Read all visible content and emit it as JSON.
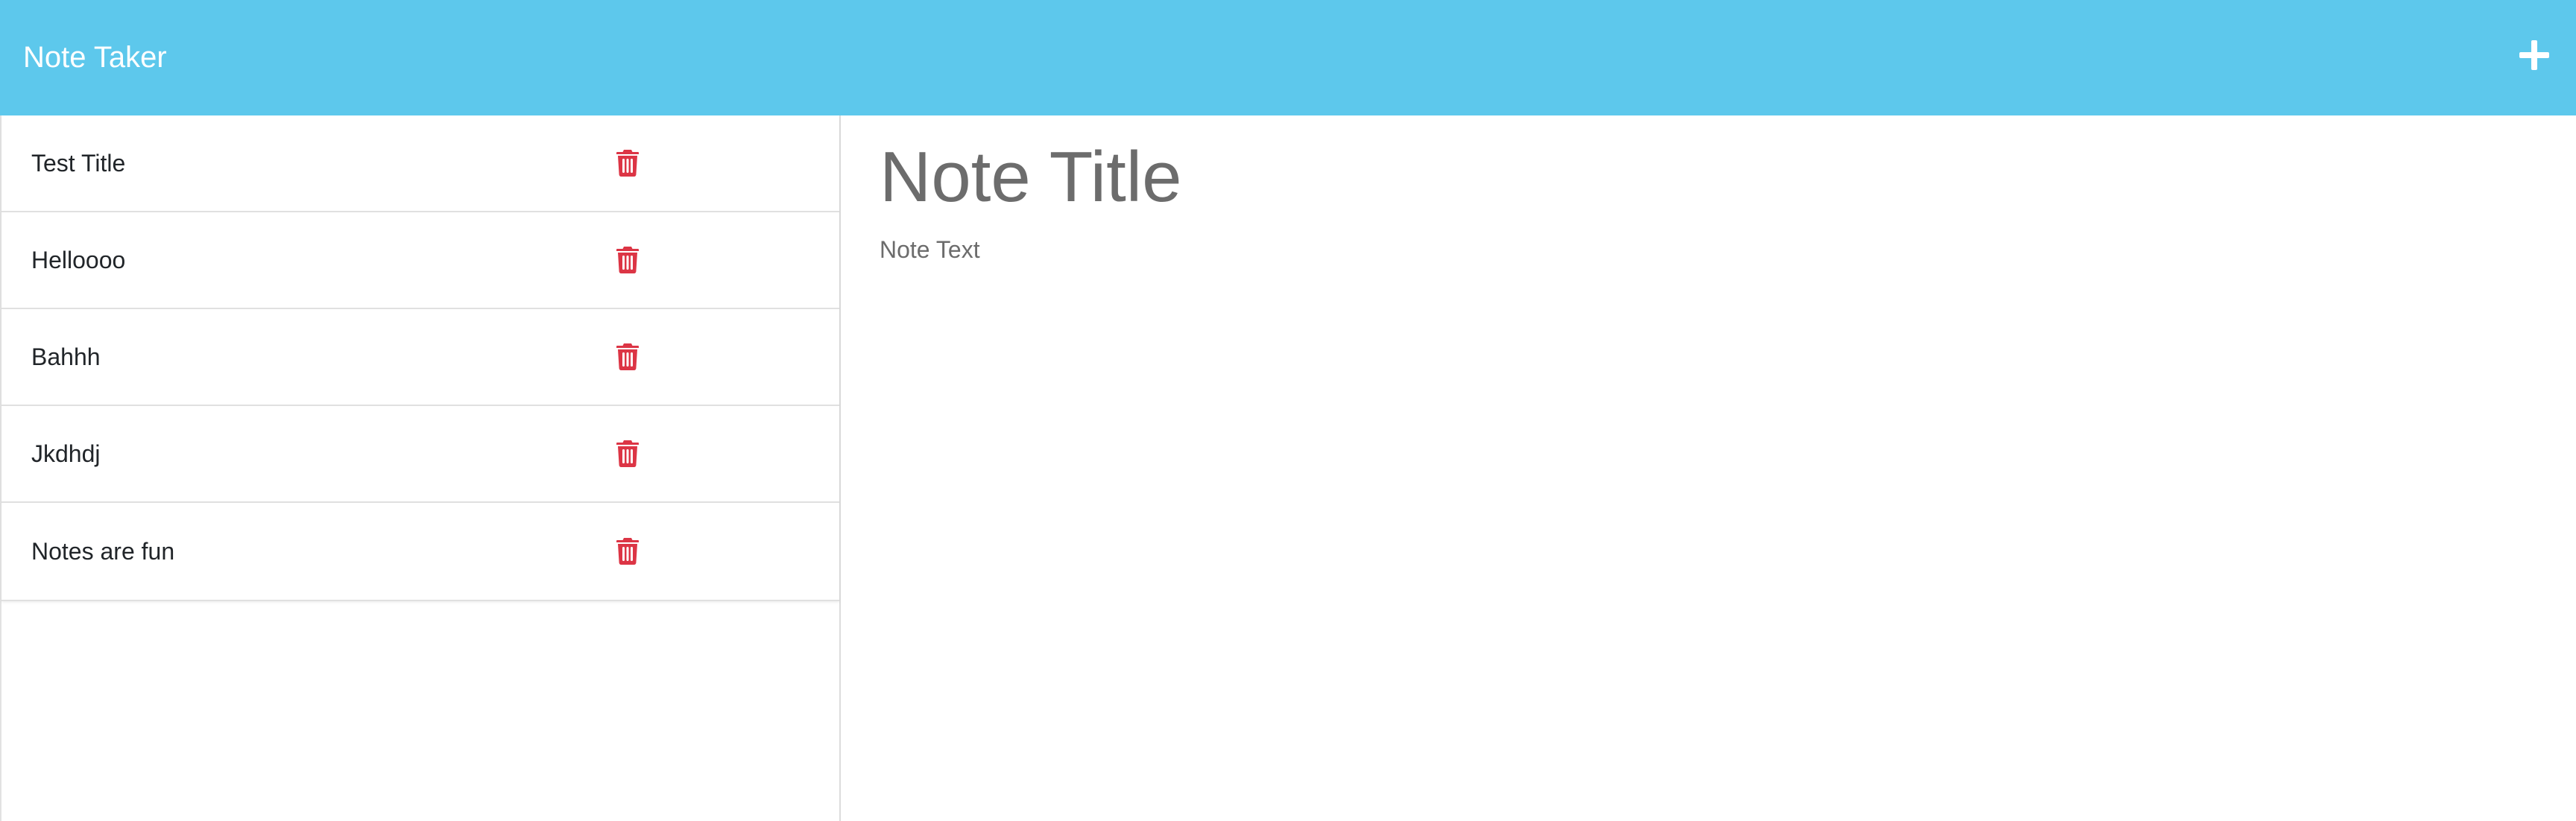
{
  "navbar": {
    "brand": "Note Taker",
    "add_icon": "plus-icon",
    "color": "#5dc8ec"
  },
  "notes": [
    {
      "title": "Test Title",
      "delete_icon": "trash-icon"
    },
    {
      "title": "Helloooo",
      "delete_icon": "trash-icon"
    },
    {
      "title": "Bahhh",
      "delete_icon": "trash-icon"
    },
    {
      "title": "Jkdhdj",
      "delete_icon": "trash-icon"
    },
    {
      "title": "Notes are fun",
      "delete_icon": "trash-icon"
    }
  ],
  "editor": {
    "title_placeholder": "Note Title",
    "text_placeholder": "Note Text",
    "title_value": "",
    "text_value": ""
  },
  "colors": {
    "accent": "#5dc8ec",
    "delete": "#dc3545"
  }
}
